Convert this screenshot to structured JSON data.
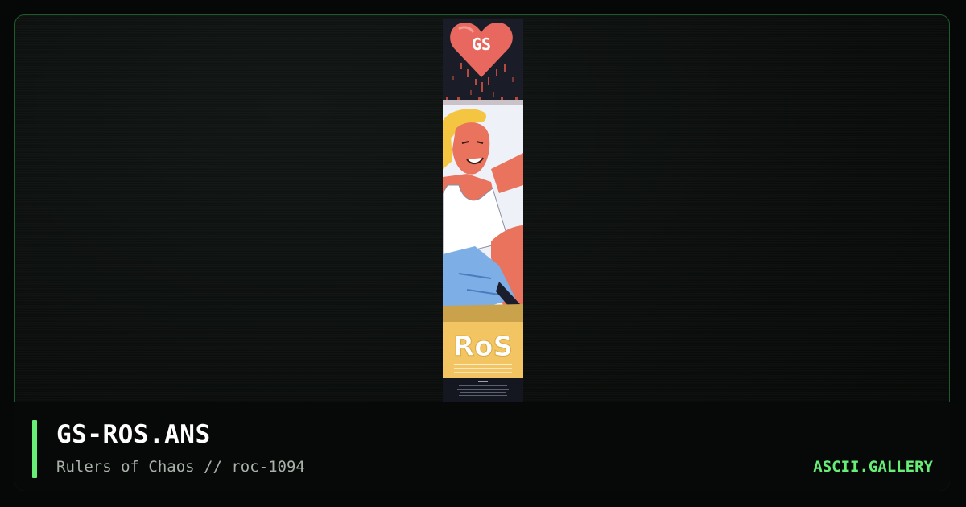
{
  "card": {
    "title": "GS-ROS.ANS",
    "subtitle": "Rulers of Chaos // roc-1094",
    "brand": "ASCII.GALLERY"
  },
  "artwork": {
    "heart_text": "GS",
    "logo_text": "RoS"
  },
  "colors": {
    "accent": "#66ee77",
    "border": "#1f5a2a",
    "heart": "#e8685f",
    "panel_gold": "#f2c462",
    "art_background": "#1a1d27"
  }
}
